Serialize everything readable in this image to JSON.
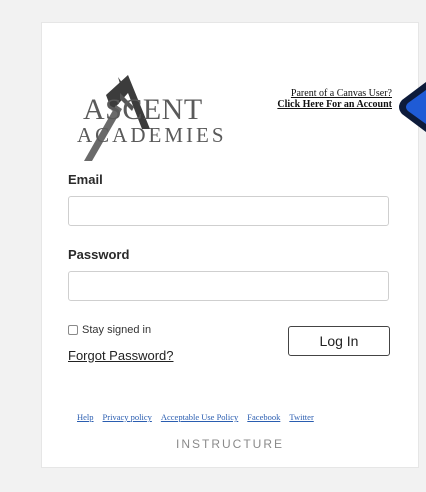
{
  "logo": {
    "line1": "ASCENT",
    "line2": "ACADEMIES"
  },
  "parent_link": {
    "line1": "Parent of a Canvas User?",
    "line2": "Click Here For an Account"
  },
  "form": {
    "email_label": "Email",
    "email_value": "",
    "password_label": "Password",
    "password_value": "",
    "stay_signed_in": "Stay signed in",
    "stay_signed_in_checked": false,
    "forgot_password": "Forgot Password?",
    "login_button": "Log In"
  },
  "footer": {
    "links": [
      "Help",
      "Privacy policy",
      "Acceptable Use Policy",
      "Facebook",
      "Twitter"
    ],
    "brand": "INSTRUCTURE"
  },
  "colors": {
    "page_bg": "#f2f2f2",
    "link": "#2a5db0",
    "badge": "#1f5bd6"
  }
}
